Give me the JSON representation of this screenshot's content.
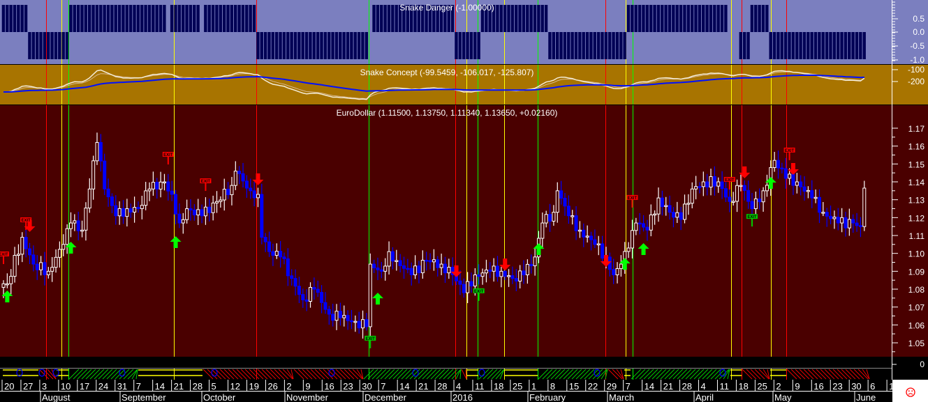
{
  "chart_data": {
    "type": "candlestick",
    "panels": [
      {
        "title": "Snake Danger (-1.00000)",
        "yticks": [
          "0.5",
          "0.0",
          "-0.5",
          "-1.0"
        ],
        "ylim": [
          -1,
          1
        ]
      },
      {
        "title": "Snake Concept (-99.5459, -106.017, -125.807)",
        "yticks": [
          "-100",
          "-200"
        ]
      },
      {
        "title": "EuroDollar (1.11500, 1.13750, 1.11340, 1.13650, +0.02160)",
        "yticks": [
          "1.17",
          "1.16",
          "1.15",
          "1.14",
          "1.13",
          "1.12",
          "1.11",
          "1.10",
          "1.09",
          "1.08",
          "1.07",
          "1.06",
          "1.05"
        ],
        "ylim": [
          1.04,
          1.183
        ]
      },
      {
        "title": "",
        "yticks": [
          "0"
        ]
      }
    ],
    "anchor_bars": [
      1,
      5,
      8,
      12,
      16,
      18,
      21,
      23,
      25,
      27,
      30,
      33,
      36,
      39,
      43,
      45,
      47,
      49,
      53,
      57,
      61,
      62,
      66,
      68,
      69,
      71,
      74,
      77,
      80,
      83,
      87,
      90,
      94,
      97,
      98,
      101,
      103,
      105,
      109,
      113,
      117,
      120,
      123,
      126,
      130,
      133,
      136,
      139,
      142,
      144,
      147,
      148,
      151,
      154,
      158,
      161,
      163,
      165,
      167,
      169,
      172,
      175,
      178,
      181,
      184,
      187,
      191,
      194,
      197,
      200,
      203,
      206,
      209,
      212,
      216,
      219,
      223,
      227,
      229,
      230
    ],
    "anchor_closes": [
      1.083,
      1.109,
      1.094,
      1.09,
      1.105,
      1.117,
      1.113,
      1.136,
      1.162,
      1.136,
      1.121,
      1.125,
      1.125,
      1.136,
      1.14,
      1.133,
      1.117,
      1.125,
      1.121,
      1.129,
      1.138,
      1.146,
      1.135,
      1.133,
      1.109,
      1.101,
      1.098,
      1.086,
      1.074,
      1.08,
      1.066,
      1.064,
      1.062,
      1.059,
      1.094,
      1.09,
      1.101,
      1.096,
      1.088,
      1.096,
      1.094,
      1.088,
      1.078,
      1.088,
      1.09,
      1.09,
      1.086,
      1.088,
      1.098,
      1.117,
      1.123,
      1.135,
      1.121,
      1.113,
      1.105,
      1.098,
      1.088,
      1.094,
      1.103,
      1.117,
      1.113,
      1.131,
      1.123,
      1.119,
      1.136,
      1.14,
      1.14,
      1.129,
      1.138,
      1.125,
      1.135,
      1.152,
      1.142,
      1.14,
      1.131,
      1.123,
      1.117,
      1.117,
      1.115,
      1.1365
    ],
    "danger_segments": [
      [
        0,
        6,
        1
      ],
      [
        7,
        17,
        -1
      ],
      [
        18,
        43,
        1
      ],
      [
        45,
        52,
        1
      ],
      [
        54,
        67,
        1
      ],
      [
        68,
        97,
        -1
      ],
      [
        99,
        120,
        1
      ],
      [
        121,
        127,
        -1
      ],
      [
        128,
        145,
        1
      ],
      [
        146,
        161,
        -1
      ],
      [
        162,
        166,
        -1
      ],
      [
        167,
        193,
        1
      ],
      [
        197,
        199,
        -1
      ],
      [
        200,
        204,
        1
      ],
      [
        205,
        230,
        -1
      ]
    ],
    "signals": {
      "buy_arrows": [
        [
          1,
          1.0761
        ],
        [
          18,
          1.1034
        ],
        [
          46,
          1.1065
        ],
        [
          100,
          1.0749
        ],
        [
          143,
          1.1026
        ],
        [
          166,
          1.0944
        ],
        [
          171,
          1.1026
        ],
        [
          205,
          1.1396
        ]
      ],
      "sell_arrows": [
        [
          7,
          1.1151
        ],
        [
          68,
          1.1412
        ],
        [
          121,
          1.0898
        ],
        [
          134,
          1.0936
        ],
        [
          161,
          1.0956
        ],
        [
          198,
          1.1451
        ],
        [
          211,
          1.147
        ]
      ],
      "exit_red": [
        [
          0,
          1.0987
        ],
        [
          6,
          1.1178
        ],
        [
          44,
          1.1544
        ],
        [
          54,
          1.1396
        ],
        [
          168,
          1.1303
        ],
        [
          194,
          1.1404
        ],
        [
          210,
          1.1568
        ]
      ],
      "exit_green": [
        [
          98,
          1.0516
        ],
        [
          127,
          1.0781
        ],
        [
          200,
          1.1197
        ]
      ],
      "exit_label": "EXIT"
    },
    "xaxis": {
      "day_labels": [
        "20",
        "27",
        "3",
        "10",
        "17",
        "24",
        "31",
        "7",
        "14",
        "21",
        "28",
        "5",
        "12",
        "19",
        "26",
        "2",
        "9",
        "16",
        "23",
        "30",
        "7",
        "14",
        "21",
        "28",
        "4",
        "11",
        "18",
        "25",
        "1",
        "8",
        "15",
        "22",
        "29",
        "7",
        "14",
        "21",
        "28",
        "4",
        "11",
        "18",
        "25",
        "2",
        "9",
        "16",
        "23",
        "30",
        "6",
        "1"
      ],
      "month_labels": [
        "August",
        "September",
        "October",
        "November",
        "December",
        "2016",
        "February",
        "March",
        "April",
        "May",
        "June"
      ]
    },
    "colors": {
      "danger_bg": "#7b7fbf",
      "danger_bar": "#000055",
      "concept_bg": "#a87400",
      "price_bg": "#4a0000",
      "up_candle": "#ffffff",
      "down_candle": "#0000ff"
    }
  },
  "status": {
    "sad_face_icon": "frown"
  }
}
